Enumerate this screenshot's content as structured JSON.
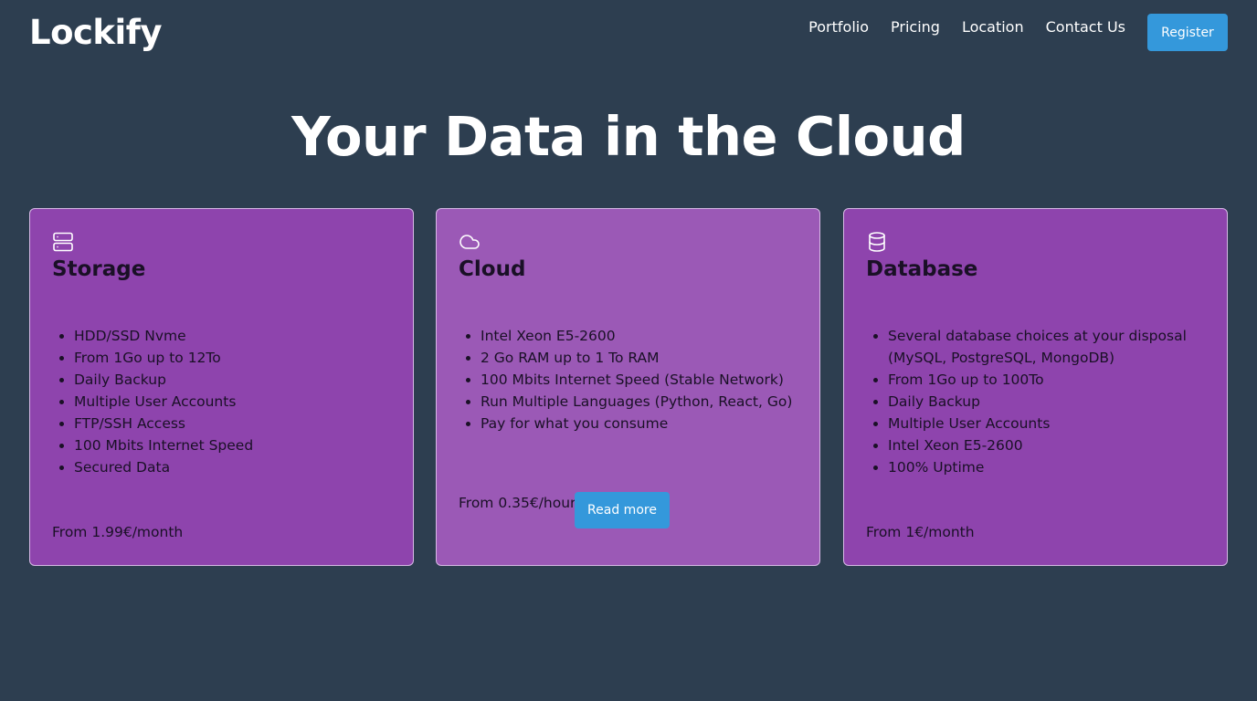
{
  "header": {
    "logo": "Lockify",
    "nav": [
      "Portfolio",
      "Pricing",
      "Location",
      "Contact Us"
    ],
    "register_label": "Register"
  },
  "hero": {
    "title": "Your Data in the Cloud"
  },
  "cards": [
    {
      "icon": "server-icon",
      "title": "Storage",
      "features": [
        "HDD/SSD Nvme",
        "From 1Go up to 12To",
        "Daily Backup",
        "Multiple User Accounts",
        "FTP/SSH Access",
        "100 Mbits Internet Speed",
        "Secured Data"
      ],
      "price": "From 1.99€/month"
    },
    {
      "icon": "cloud-icon",
      "title": "Cloud",
      "features": [
        "Intel Xeon E5-2600",
        "2 Go RAM up to 1 To RAM",
        "100 Mbits Internet Speed (Stable Network)",
        "Run Multiple Languages (Python, React, Go)",
        "Pay for what you consume"
      ],
      "price": "From 0.35€/hour",
      "button_label": "Read more"
    },
    {
      "icon": "database-icon",
      "title": "Database",
      "features": [
        "Several database choices at your disposal (MySQL, PostgreSQL, MongoDB)",
        "From 1Go up to 100To",
        "Daily Backup",
        "Multiple User Accounts",
        "Intel Xeon E5-2600",
        "100% Uptime"
      ],
      "price": "From 1€/month"
    }
  ],
  "colors": {
    "background": "#2d3e50",
    "card": "#8e44ad",
    "card_highlight": "#9b59b6",
    "accent": "#3498db"
  }
}
